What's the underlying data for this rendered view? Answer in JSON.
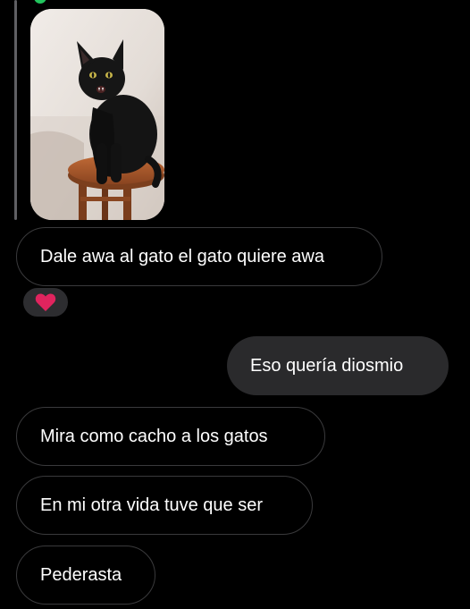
{
  "thread": {
    "incoming_image": {
      "subject": "black cat sitting on a wooden stool"
    },
    "messages": [
      {
        "id": "m1",
        "direction": "incoming",
        "text": "Dale awa al gato el gato quiere awa"
      },
      {
        "id": "m2",
        "direction": "outgoing",
        "text": "Eso quería diosmio"
      },
      {
        "id": "m3",
        "direction": "incoming",
        "text": "Mira como cacho a los gatos"
      },
      {
        "id": "m4",
        "direction": "incoming",
        "text": "En mi otra vida tuve que ser"
      },
      {
        "id": "m5",
        "direction": "incoming",
        "text": "Pederasta"
      }
    ],
    "reaction": {
      "emoji_icon": "red-heart-icon"
    }
  },
  "colors": {
    "background": "#000000",
    "incoming_border": "#3a3a3c",
    "outgoing_fill": "#2a2a2c",
    "text": "#ffffff",
    "heart": "#e0245e"
  }
}
